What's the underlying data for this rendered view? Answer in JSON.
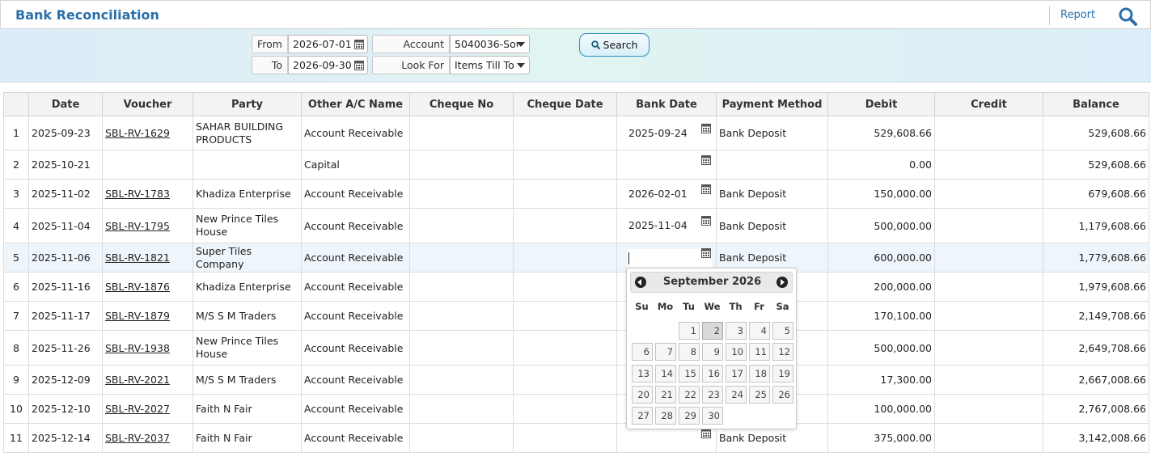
{
  "header": {
    "title": "Bank Reconciliation",
    "report_label": "Report"
  },
  "filters": {
    "from_label": "From",
    "from_value": "2026-07-01",
    "to_label": "To",
    "to_value": "2026-09-30",
    "account_label": "Account",
    "account_value": "5040036-Sou",
    "lookfor_label": "Look For",
    "lookfor_value": "Items Till To",
    "search_label": "Search"
  },
  "table": {
    "columns": [
      "",
      "Date",
      "Voucher",
      "Party",
      "Other A/C Name",
      "Cheque No",
      "Cheque Date",
      "Bank Date",
      "Payment Method",
      "Debit",
      "Credit",
      "Balance"
    ],
    "rows": [
      {
        "n": "1",
        "date": "2025-09-23",
        "voucher": "SBL-RV-1629",
        "party": "SAHAR BUILDING PRODUCTS",
        "other": "Account Receivable",
        "cheque_no": "",
        "cheque_date": "",
        "bank_date": "2025-09-24",
        "method": "Bank Deposit",
        "debit": "529,608.66",
        "credit": "",
        "balance": "529,608.66"
      },
      {
        "n": "2",
        "date": "2025-10-21",
        "voucher": "",
        "party": "",
        "other": "Capital",
        "cheque_no": "",
        "cheque_date": "",
        "bank_date": "",
        "method": "",
        "debit": "0.00",
        "credit": "",
        "balance": "529,608.66"
      },
      {
        "n": "3",
        "date": "2025-11-02",
        "voucher": "SBL-RV-1783",
        "party": "Khadiza Enterprise",
        "other": "Account Receivable",
        "cheque_no": "",
        "cheque_date": "",
        "bank_date": "2026-02-01",
        "method": "Bank Deposit",
        "debit": "150,000.00",
        "credit": "",
        "balance": "679,608.66"
      },
      {
        "n": "4",
        "date": "2025-11-04",
        "voucher": "SBL-RV-1795",
        "party": "New Prince Tiles House",
        "other": "Account Receivable",
        "cheque_no": "",
        "cheque_date": "",
        "bank_date": "2025-11-04",
        "method": "Bank Deposit",
        "debit": "500,000.00",
        "credit": "",
        "balance": "1,179,608.66"
      },
      {
        "n": "5",
        "date": "2025-11-06",
        "voucher": "SBL-RV-1821",
        "party": "Super Tiles Company",
        "other": "Account Receivable",
        "cheque_no": "",
        "cheque_date": "",
        "bank_date": "",
        "method": "Bank Deposit",
        "debit": "600,000.00",
        "credit": "",
        "balance": "1,779,608.66"
      },
      {
        "n": "6",
        "date": "2025-11-16",
        "voucher": "SBL-RV-1876",
        "party": "Khadiza Enterprise",
        "other": "Account Receivable",
        "cheque_no": "",
        "cheque_date": "",
        "bank_date": "",
        "method": "",
        "debit": "200,000.00",
        "credit": "",
        "balance": "1,979,608.66"
      },
      {
        "n": "7",
        "date": "2025-11-17",
        "voucher": "SBL-RV-1879",
        "party": "M/S S M Traders",
        "other": "Account Receivable",
        "cheque_no": "",
        "cheque_date": "",
        "bank_date": "",
        "method": "",
        "debit": "170,100.00",
        "credit": "",
        "balance": "2,149,708.66"
      },
      {
        "n": "8",
        "date": "2025-11-26",
        "voucher": "SBL-RV-1938",
        "party": "New Prince Tiles House",
        "other": "Account Receivable",
        "cheque_no": "",
        "cheque_date": "",
        "bank_date": "",
        "method": "",
        "debit": "500,000.00",
        "credit": "",
        "balance": "2,649,708.66"
      },
      {
        "n": "9",
        "date": "2025-12-09",
        "voucher": "SBL-RV-2021",
        "party": "M/S S M Traders",
        "other": "Account Receivable",
        "cheque_no": "",
        "cheque_date": "",
        "bank_date": "",
        "method": "",
        "debit": "17,300.00",
        "credit": "",
        "balance": "2,667,008.66"
      },
      {
        "n": "10",
        "date": "2025-12-10",
        "voucher": "SBL-RV-2027",
        "party": "Faith N Fair",
        "other": "Account Receivable",
        "cheque_no": "",
        "cheque_date": "",
        "bank_date": "",
        "method": "",
        "debit": "100,000.00",
        "credit": "",
        "balance": "2,767,008.66"
      },
      {
        "n": "11",
        "date": "2025-12-14",
        "voucher": "SBL-RV-2037",
        "party": "Faith N Fair",
        "other": "Account Receivable",
        "cheque_no": "",
        "cheque_date": "",
        "bank_date": "",
        "method": "Bank Deposit",
        "debit": "375,000.00",
        "credit": "",
        "balance": "3,142,008.66"
      }
    ]
  },
  "datepicker": {
    "month_label": "September 2026",
    "weekdays": [
      "Su",
      "Mo",
      "Tu",
      "We",
      "Th",
      "Fr",
      "Sa"
    ],
    "first_weekday": 2,
    "days": 30,
    "highlighted_day": 2
  },
  "icons": {
    "calendar": "calendar-icon",
    "search": "search-icon",
    "prev": "prev-month-icon",
    "next": "next-month-icon"
  },
  "colors": {
    "title": "#2a6fa8",
    "search_border": "#2e8fbe",
    "selected_row": "#eef5fb"
  }
}
